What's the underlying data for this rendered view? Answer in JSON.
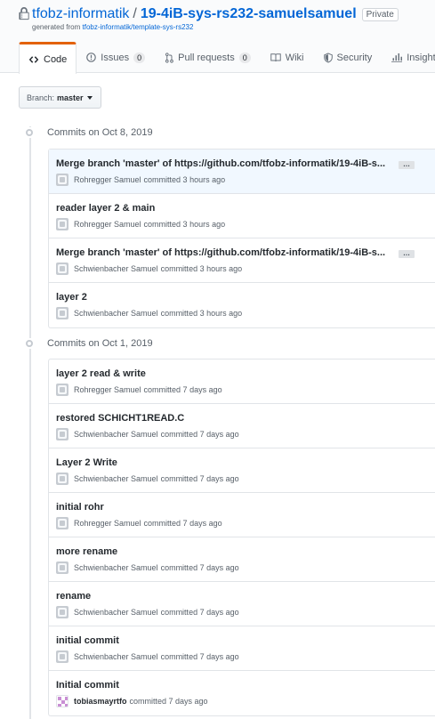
{
  "repo": {
    "owner": "tfobz-informatik",
    "separator": "/",
    "name": "19-4iB-sys-rs232-samuelsamuel",
    "visibility": "Private",
    "generated_prefix": "generated from",
    "template": "tfobz-informatik/template-sys-rs232"
  },
  "tabs": [
    {
      "label": "Code",
      "icon": "code-icon"
    },
    {
      "label": "Issues",
      "icon": "issue-icon",
      "count": "0"
    },
    {
      "label": "Pull requests",
      "icon": "pull-request-icon",
      "count": "0"
    },
    {
      "label": "Wiki",
      "icon": "book-icon"
    },
    {
      "label": "Security",
      "icon": "shield-icon"
    },
    {
      "label": "Insights",
      "icon": "graph-icon"
    }
  ],
  "branch": {
    "prefix": "Branch:",
    "name": "master"
  },
  "groups": [
    {
      "date_label": "Commits on Oct 8, 2019",
      "commits": [
        {
          "message": "Merge branch 'master' of https://github.com/tfobz-informatik/19-4iB-s...",
          "author": "Rohregger Samuel",
          "action": "committed 3 hours ago",
          "ellipsis": "…"
        },
        {
          "message": "reader layer 2 & main",
          "author": "Rohregger Samuel",
          "action": "committed 3 hours ago"
        },
        {
          "message": "Merge branch 'master' of https://github.com/tfobz-informatik/19-4iB-s...",
          "author": "Schwienbacher Samuel",
          "action": "committed 3 hours ago",
          "ellipsis": "…"
        },
        {
          "message": "layer 2",
          "author": "Schwienbacher Samuel",
          "action": "committed 3 hours ago"
        }
      ]
    },
    {
      "date_label": "Commits on Oct 1, 2019",
      "commits": [
        {
          "message": "layer 2 read & write",
          "author": "Rohregger Samuel",
          "action": "committed 7 days ago"
        },
        {
          "message": "restored SCHICHT1READ.C",
          "author": "Schwienbacher Samuel",
          "action": "committed 7 days ago"
        },
        {
          "message": "Layer 2 Write",
          "author": "Schwienbacher Samuel",
          "action": "committed 7 days ago"
        },
        {
          "message": "initial rohr",
          "author": "Rohregger Samuel",
          "action": "committed 7 days ago"
        },
        {
          "message": "more rename",
          "author": "Schwienbacher Samuel",
          "action": "committed 7 days ago"
        },
        {
          "message": "rename",
          "author": "Schwienbacher Samuel",
          "action": "committed 7 days ago"
        },
        {
          "message": "initial commit",
          "author": "Schwienbacher Samuel",
          "action": "committed 7 days ago"
        },
        {
          "message": "Initial commit",
          "author": "tobiasmayrtfo",
          "action": "committed 7 days ago"
        }
      ]
    }
  ],
  "colors": {
    "link": "#0366d6",
    "tab_accent": "#e36209",
    "highlight_row": "#f1f8ff"
  }
}
